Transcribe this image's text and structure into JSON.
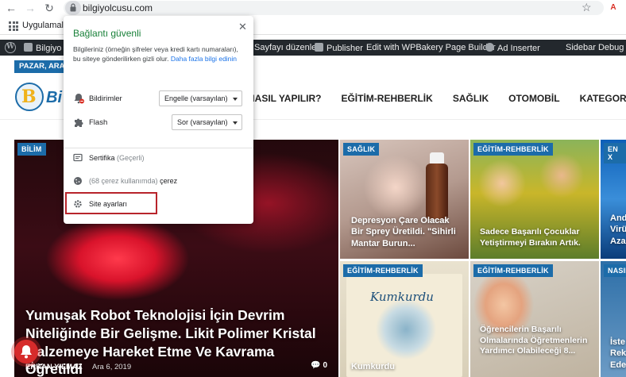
{
  "browser": {
    "url": "bilgiyolcusu.com",
    "bookmarks_label": "Uygulamalar"
  },
  "wp_admin_bar": {
    "site_name": "Bilgiyo",
    "items": [
      {
        "label": "Sayfayı düzenle"
      },
      {
        "label": "Publisher"
      },
      {
        "label": "Edit with WPBakery Page Builder"
      },
      {
        "label": "Ad Inserter"
      },
      {
        "label": "Sidebar Debug"
      }
    ]
  },
  "site_header": {
    "date_badge": "PAZAR, ARAL",
    "logo_letter": "B",
    "logo_text": "Bi",
    "nav": [
      "NASIL YAPILIR?",
      "EĞİTİM-REHBERLİK",
      "SAĞLIK",
      "OTOMOBİL",
      "KATEGORİLER"
    ]
  },
  "hero": {
    "category": "BİLİM",
    "title": "Yumuşak Robot Teknolojisi İçin Devrim Niteliğinde Bir Gelişme. Likit Polimer Kristal Malzemeye Hareket Etme Ve Kavrama Öğretildi",
    "author": "ERKAN YILMAZ",
    "date": "Ara 6, 2019",
    "comments": "0"
  },
  "tiles": [
    {
      "category": "SAĞLIK",
      "title": "Depresyon Çare Olacak Bir Sprey Üretildi. \"Sihirli Mantar Burun..."
    },
    {
      "category": "EĞİTİM-REHBERLİK",
      "title": "Sadece Başarılı Çocuklar Yetiştirmeyi Bırakın Artık."
    },
    {
      "category": "EN X",
      "title": "Andr Virü Aza"
    },
    {
      "category": "EĞİTİM-REHBERLİK",
      "title": "Kumkurdu",
      "book_title": "Kumkurdu"
    },
    {
      "category": "EĞİTİM-REHBERLİK",
      "title": "Öğrencilerin Başarılı Olmalarında Öğretmenlerin Yardımcı Olabileceği 8..."
    },
    {
      "category": "NASIL",
      "title": "İste Rek Ede"
    }
  ],
  "site_info_popup": {
    "title": "Bağlantı güvenli",
    "description": "Bilgileriniz (örneğin şifreler veya kredi kartı numaraları), bu siteye gönderilirken gizli olur.",
    "learn_more": "Daha fazla bilgi edinin",
    "permissions": [
      {
        "label": "Bildirimler",
        "value": "Engelle (varsayılan)",
        "icon": "notifications-blocked-icon"
      },
      {
        "label": "Flash",
        "value": "Sor (varsayılan)",
        "icon": "puzzle-icon"
      }
    ],
    "certificate_label": "Sertifika",
    "certificate_status": "(Geçerli)",
    "cookies_count": "(68 çerez kullanımda)",
    "cookies_label": "çerez",
    "site_settings": "Site ayarları"
  },
  "colors": {
    "brand_blue": "#1c6ca9",
    "secure_green": "#188038",
    "highlight_red": "#b8242b",
    "admin_bar": "#23282d"
  }
}
